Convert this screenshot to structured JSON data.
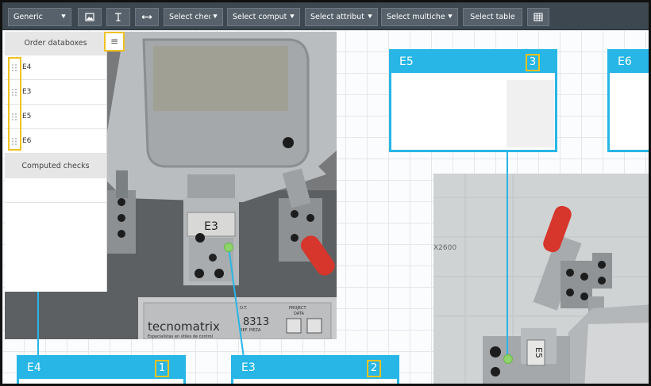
{
  "toolbar": {
    "mode_select": "Generic",
    "select_checks": "Select checl",
    "select_computed": "Select compute",
    "select_attributes": "Select attribute",
    "select_multicheck": "Select multicheck",
    "select_table": "Select table",
    "icons": [
      "image-icon",
      "text-cursor-icon",
      "horizontal-arrows-icon",
      "grid-table-icon"
    ]
  },
  "panel": {
    "order_header": "Order databoxes",
    "items": [
      "E4",
      "E3",
      "E5",
      "E6"
    ],
    "computed_header": "Computed checks"
  },
  "photo1": {
    "label_plate": "E3",
    "brand": "tecnomatrix",
    "brand_sub": "Especialistas en útiles de control",
    "number": "8313",
    "small_1": "O.T.",
    "small_2": "REF. PIEZA",
    "small_3": "PROJECT",
    "small_4": "DATA"
  },
  "photo2": {
    "label_plate": "E5",
    "marking": "X2600"
  },
  "cards": [
    {
      "label": "E5",
      "number": "3"
    },
    {
      "label": "E6",
      "number": ""
    },
    {
      "label": "E4",
      "number": "1"
    },
    {
      "label": "E3",
      "number": "2"
    }
  ],
  "colors": {
    "toolbar": "#3d4750",
    "card_blue": "#27b6e6",
    "highlight": "#f0c220",
    "dot_green": "#8ed46a"
  }
}
